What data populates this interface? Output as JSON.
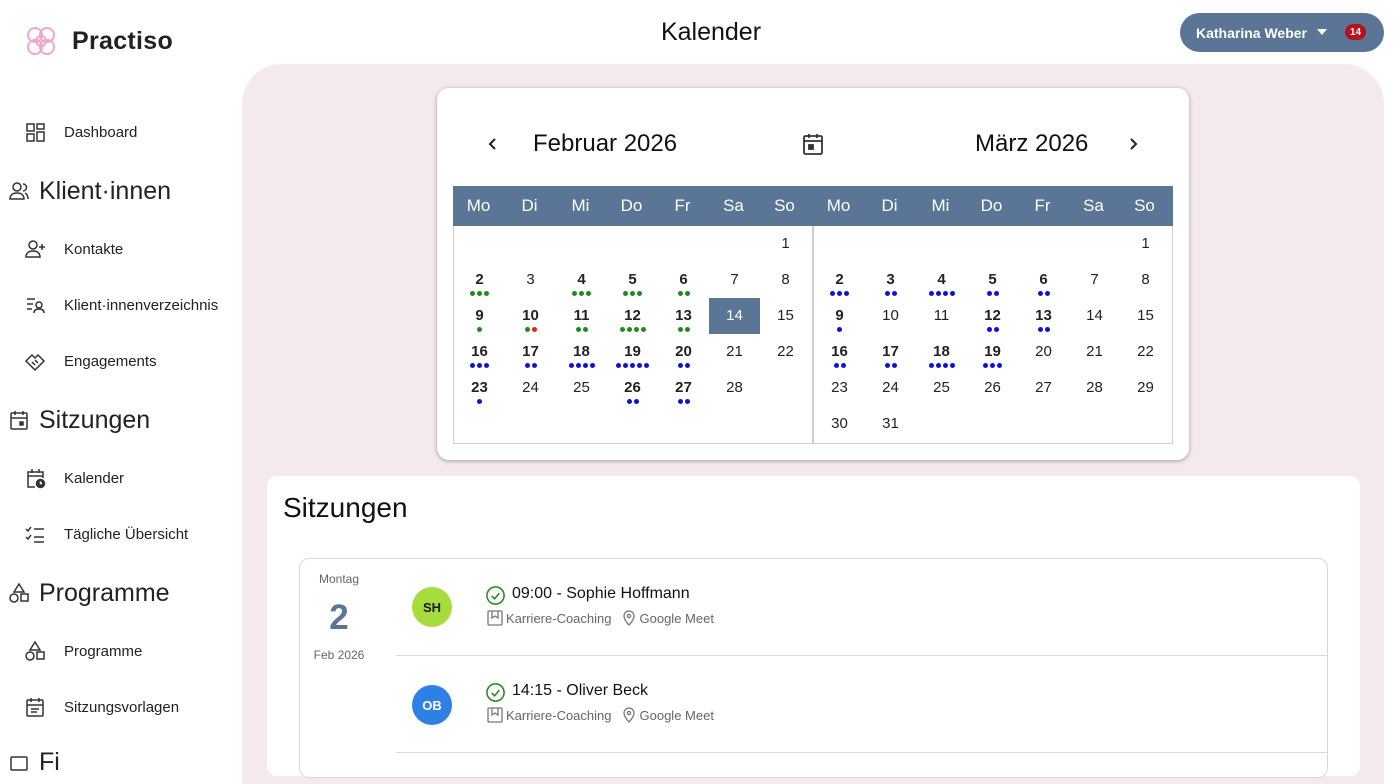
{
  "app": {
    "name": "Practiso",
    "page_title": "Kalender"
  },
  "user": {
    "name": "Katharina Weber",
    "notifications": "14"
  },
  "sidebar": {
    "dashboard": "Dashboard",
    "section_clients": "Klient·innen",
    "contacts": "Kontakte",
    "client_directory": "Klient·innenverzeichnis",
    "engagements": "Engagements",
    "section_sessions": "Sitzungen",
    "calendar": "Kalender",
    "daily_overview": "Tägliche Übersicht",
    "section_programs": "Programme",
    "programs": "Programme",
    "session_templates": "Sitzungsvorlagen",
    "section_partial": "Fi"
  },
  "calendar": {
    "weekdays": [
      "Mo",
      "Di",
      "Mi",
      "Do",
      "Fr",
      "Sa",
      "So"
    ],
    "months": [
      {
        "title": "Februar 2026",
        "offset": 6,
        "days": 28,
        "today": 14,
        "events": {
          "2": "ggg",
          "4": "ggg",
          "5": "ggg",
          "6": "gg",
          "9": "g",
          "10": "gr",
          "11": "gg",
          "12": "gggg",
          "13": "gg",
          "16": "bbb",
          "17": "bb",
          "18": "bbbb",
          "19": "bbbbb",
          "20": "bb",
          "23": "b",
          "26": "bb",
          "27": "bb"
        }
      },
      {
        "title": "März 2026",
        "offset": 6,
        "days": 31,
        "today": null,
        "events": {
          "2": "bbb",
          "3": "bb",
          "4": "bbbb",
          "5": "bb",
          "6": "bb",
          "9": "b",
          "12": "bb",
          "13": "bb",
          "16": "bb",
          "17": "bb",
          "18": "bbbb",
          "19": "bbb"
        }
      }
    ]
  },
  "sessions": {
    "title": "Sitzungen",
    "day": {
      "weekday": "Montag",
      "number": "2",
      "month": "Feb 2026"
    },
    "items": [
      {
        "initials": "SH",
        "avatar_color": "#a6dd3c",
        "avatar_text_color": "#1a1a1a",
        "time_name": "09:00 - Sophie Hoffmann",
        "program": "Karriere-Coaching",
        "location": "Google Meet"
      },
      {
        "initials": "OB",
        "avatar_color": "#2f80e4",
        "avatar_text_color": "#ffffff",
        "time_name": "14:15 - Oliver Beck",
        "program": "Karriere-Coaching",
        "location": "Google Meet"
      }
    ]
  },
  "colors": {
    "accent": "#5a7595",
    "panel": "#f4eaeb",
    "badge": "#b3121f"
  }
}
